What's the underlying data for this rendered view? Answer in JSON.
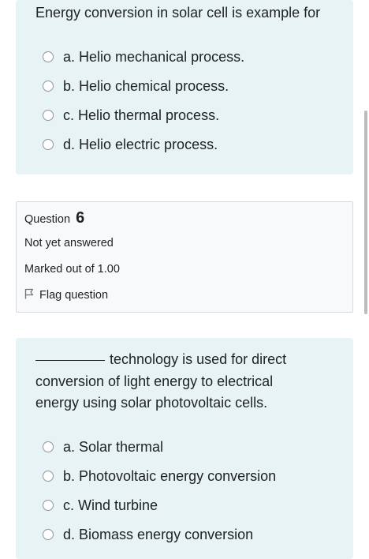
{
  "question_prev": {
    "text": "Energy conversion in solar cell is example for",
    "options": [
      {
        "label": "a. Helio mechanical process."
      },
      {
        "label": "b. Helio chemical process."
      },
      {
        "label": "c. Helio thermal process."
      },
      {
        "label": "d. Helio electric process."
      }
    ]
  },
  "question_info": {
    "label": "Question",
    "number": "6",
    "state": "Not yet answered",
    "grade": "Marked out of 1.00",
    "flag_label": "Flag question"
  },
  "question_6": {
    "text_line1": "technology is used for direct",
    "text_line2": "conversion of light energy to electrical",
    "text_line3": "energy using solar photovoltaic cells.",
    "options": [
      {
        "label": "a. Solar thermal"
      },
      {
        "label": "b. Photovoltaic energy conversion"
      },
      {
        "label": "c. Wind turbine"
      },
      {
        "label": "d. Biomass energy conversion"
      }
    ]
  },
  "icons": {
    "radio": "radio-unchecked-icon",
    "flag": "flag-outline-icon"
  },
  "colors": {
    "card_background": "#e7f3f5",
    "info_background": "#f8f9fa",
    "text": "#1d2125",
    "radio_border": "#8f959e"
  }
}
